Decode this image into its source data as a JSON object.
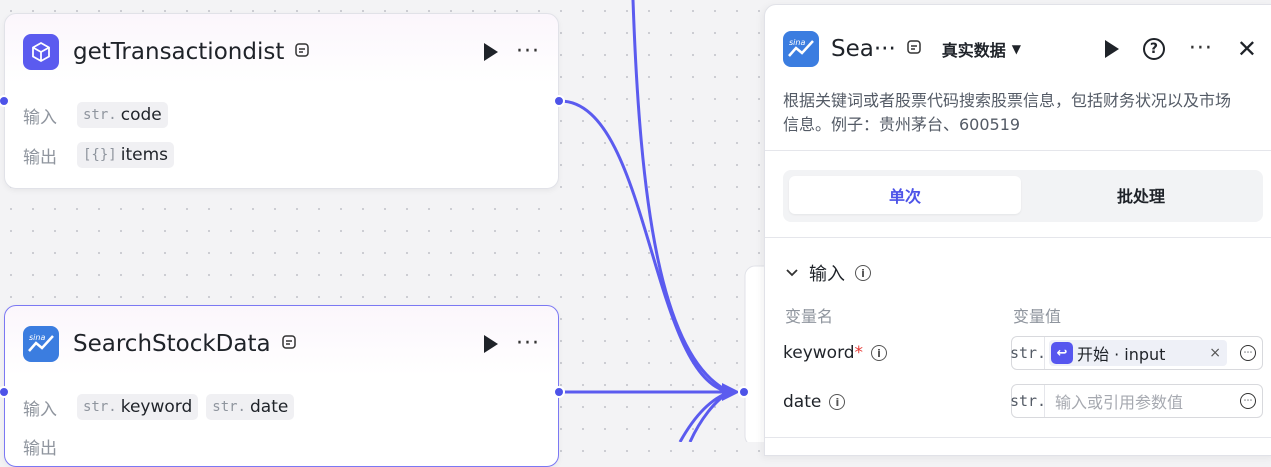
{
  "node_top": {
    "title": "getTransactiondist",
    "input_label": "输入",
    "output_label": "输出",
    "inputs": [
      {
        "type": "str.",
        "name": "code"
      }
    ],
    "outputs": [
      {
        "type": "[{}]",
        "name": "items"
      }
    ]
  },
  "node_bottom": {
    "title": "SearchStockData",
    "input_label": "输入",
    "output_label": "输出",
    "inputs": [
      {
        "type": "str.",
        "name": "keyword"
      },
      {
        "type": "str.",
        "name": "date"
      }
    ]
  },
  "panel": {
    "title": "Sea···",
    "data_source": "真实数据",
    "description": "根据关键词或者股票代码搜索股票信息，包括财务状况以及市场信息。例子：贵州茅台、600519",
    "tabs": [
      "单次",
      "批处理"
    ],
    "section_title": "输入",
    "col_name": "变量名",
    "col_value": "变量值",
    "vars": [
      {
        "name": "keyword",
        "required_mark": "*",
        "type": "str.",
        "ref_text": "开始 · input",
        "clear": "×"
      },
      {
        "name": "date",
        "type": "str.",
        "placeholder": "输入或引用参数值"
      }
    ]
  },
  "icons": [
    "cube-icon",
    "sina-logo-icon",
    "library-icon",
    "play-icon",
    "more-icon",
    "help-icon",
    "close-icon",
    "chevron-down-icon",
    "info-icon",
    "reference-icon"
  ],
  "colors": {
    "accent": "#4d53e8",
    "edge": "#5b5bef",
    "node_border_selected": "#7b78f3",
    "required": "#e53935"
  }
}
